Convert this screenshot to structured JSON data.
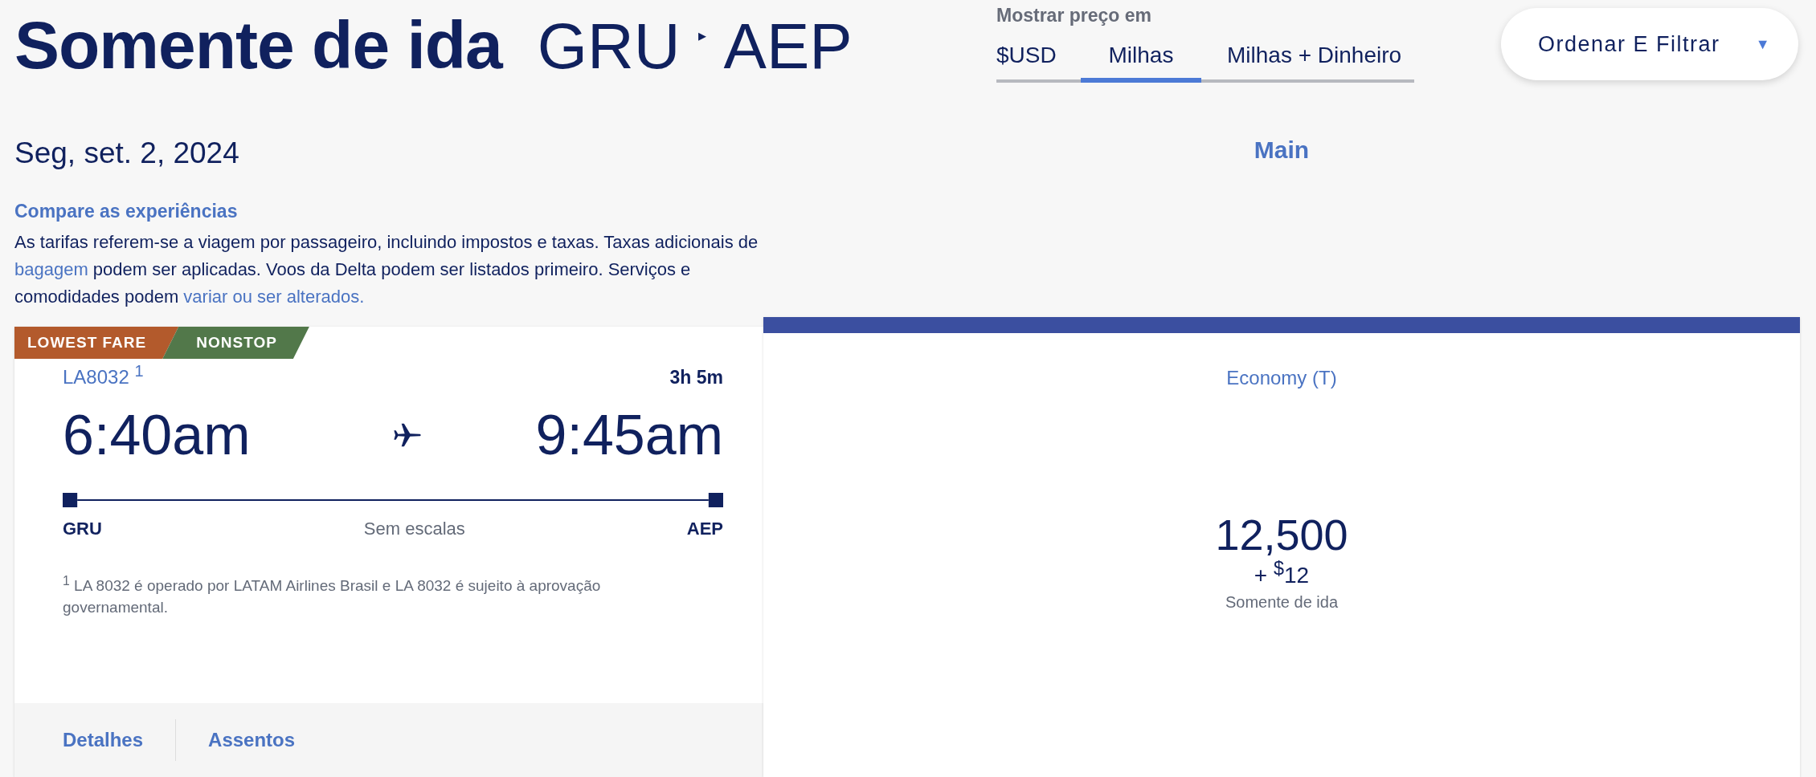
{
  "header": {
    "title": "Somente de ida",
    "origin": "GRU",
    "arrow": "▸",
    "destination": "AEP"
  },
  "price_display": {
    "label": "Mostrar preço em",
    "tabs": [
      {
        "label": "$USD",
        "selected": false
      },
      {
        "label": "Milhas",
        "selected": true
      },
      {
        "label": "Milhas + Dinheiro",
        "selected": false
      }
    ]
  },
  "sort_button": {
    "label": "Ordenar E Filtrar",
    "caret": "▼"
  },
  "date": "Seg, set. 2, 2024",
  "cabin_header": "Main",
  "compare": {
    "title": "Compare as experiências",
    "paragraph": [
      {
        "kind": "text",
        "text": "As tarifas referem-se a viagem por passageiro, incluindo impostos e taxas. Taxas adicionais de "
      },
      {
        "kind": "link",
        "text": "bagagem"
      },
      {
        "kind": "text",
        "text": " podem ser aplicadas. Voos da Delta podem ser listados primeiro. Serviços e comodidades podem "
      },
      {
        "kind": "link",
        "text": "variar ou ser alterados."
      }
    ]
  },
  "flight": {
    "badges": [
      {
        "label": "LOWEST FARE",
        "color": "#b35a2c"
      },
      {
        "label": "NONSTOP",
        "color": "#52784a"
      }
    ],
    "flight_number": "LA8032 $^{1}$",
    "duration": "3h 5m",
    "departure": "6:40am",
    "arrival": "9:45am",
    "origin": "GRU",
    "stops": "Sem escalas",
    "destination": "AEP",
    "footnote": "$^{1}$  LA 8032 é operado por LATAM Airlines Brasil e LA 8032 é sujeito à aprovação governamental.",
    "actions": [
      "Detalhes",
      "Assentos"
    ]
  },
  "fare": {
    "cabin": "Economy (T)",
    "miles": "12,500",
    "cash": "+ $^{$}$12",
    "note": "Somente de ida"
  }
}
